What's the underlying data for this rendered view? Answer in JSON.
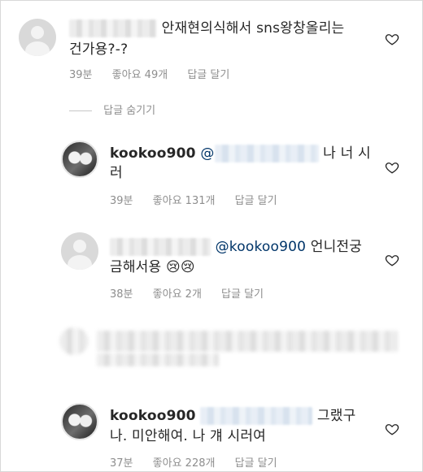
{
  "comments": [
    {
      "text": "안재현의식해서 sns왕창올리는",
      "text_line2": "건가용?-?",
      "time": "39분",
      "likes": "좋아요 49개",
      "reply": "답글 달기"
    },
    {
      "username": "kookoo900",
      "mention_start": "@",
      "text": "나 너 시",
      "text_line2": "러",
      "time": "39분",
      "likes": "좋아요 131개",
      "reply": "답글 달기"
    },
    {
      "mention": "@kookoo900",
      "text": "언니전궁",
      "text_line2": "금해서용",
      "emoji": "😢😢",
      "time": "38분",
      "likes": "좋아요 2개",
      "reply": "답글 달기"
    },
    {
      "username": "kookoo900",
      "text": "그랬구",
      "text_line2": "나. 미안해여. 나 걔 시러여",
      "time": "37분",
      "likes": "좋아요 228개",
      "reply": "답글 달기"
    }
  ],
  "hide_replies": "답글 숨기기",
  "icons": {
    "like": "heart-icon",
    "avatar": "avatar"
  },
  "colors": {
    "text": "#262626",
    "meta": "#8e8e8e",
    "mention": "#003569"
  }
}
